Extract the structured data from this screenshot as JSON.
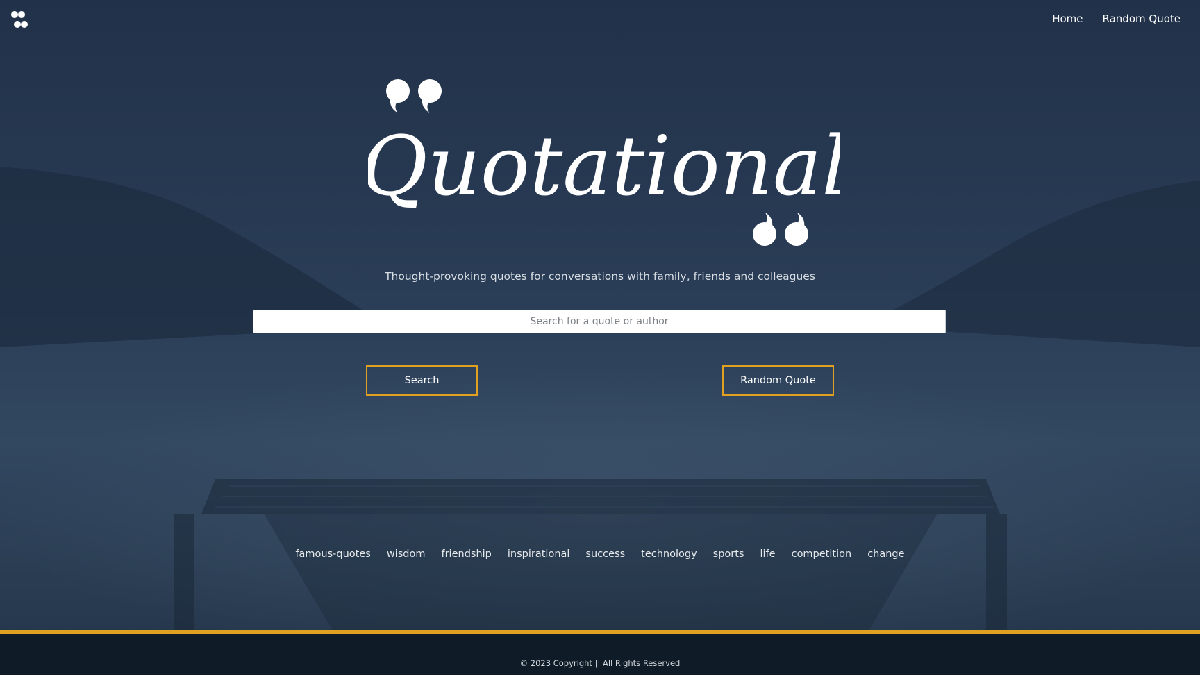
{
  "header": {
    "nav": {
      "home": "Home",
      "random_quote": "Random Quote"
    }
  },
  "hero": {
    "wordmark": "Quotational",
    "tagline": "Thought-provoking quotes for conversations with family, friends and colleagues",
    "search_placeholder": "Search for a quote or author",
    "search_button": "Search",
    "random_button": "Random Quote"
  },
  "tags": [
    "famous-quotes",
    "wisdom",
    "friendship",
    "inspirational",
    "success",
    "technology",
    "sports",
    "life",
    "competition",
    "change"
  ],
  "footer": {
    "copyright": "© 2023 Copyright || All Rights Reserved"
  },
  "colors": {
    "accent": "#e0a020",
    "background": "#283a52",
    "footer": "#0f1c28"
  },
  "icons": {
    "logo": "quote-marks-icon"
  }
}
